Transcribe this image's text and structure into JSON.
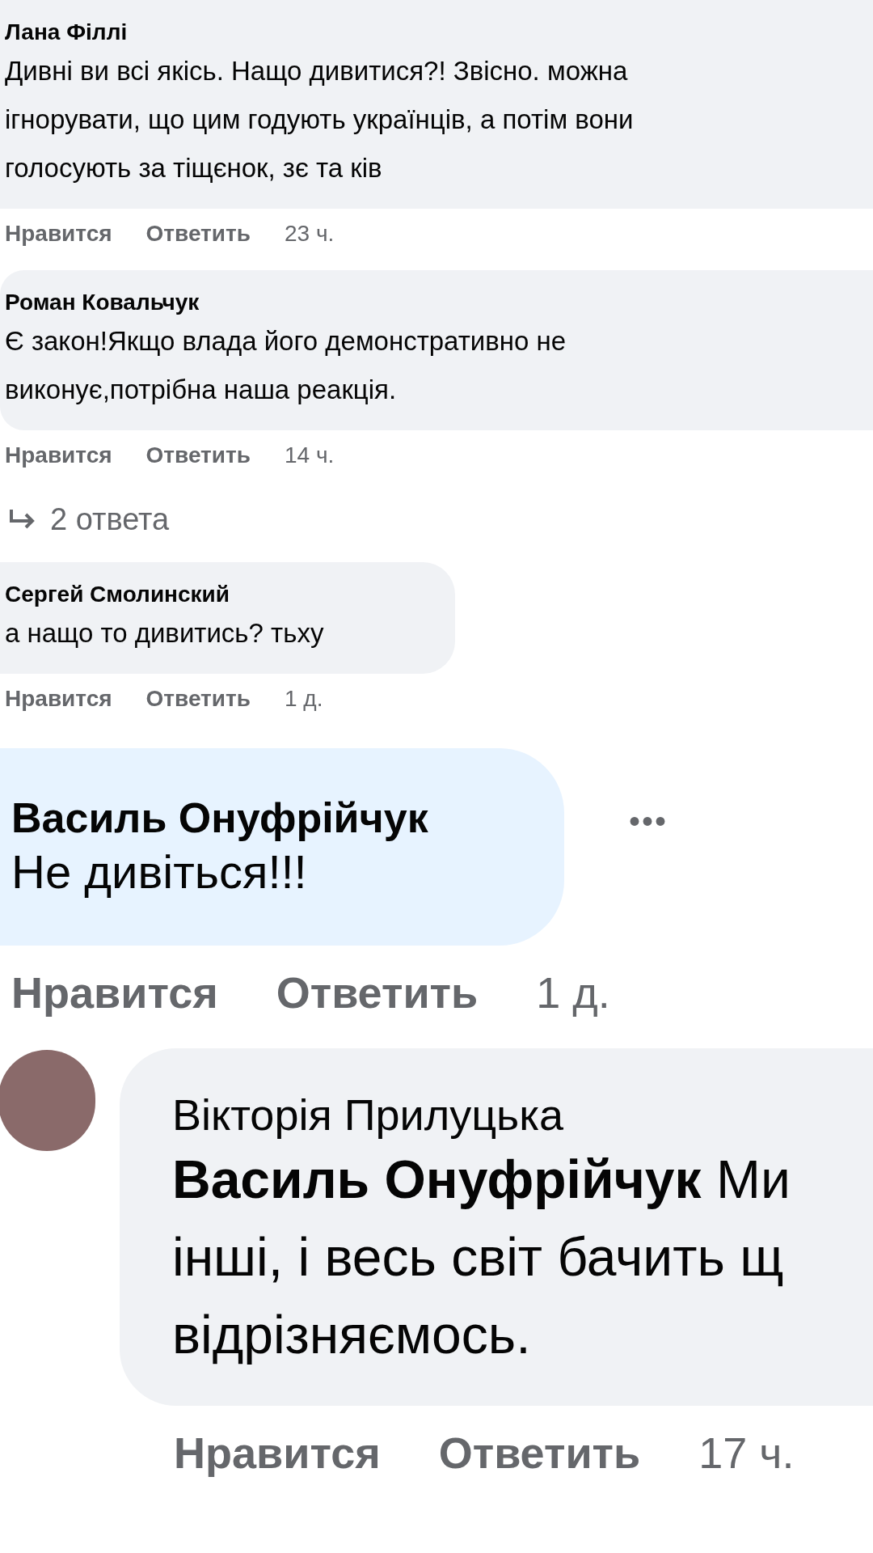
{
  "comments": [
    {
      "kind": "small",
      "color": "#f0f2f5",
      "author": "Лана Філлі",
      "lines": [
        "Дивні ви всі якісь. Нащо дивитися?! Звісно. можна",
        "ігнорувати, що цим годують українців, а потім вони",
        "голосують за тіщєнок, зє та ків"
      ],
      "actions": [
        "Нравится",
        "Ответить"
      ],
      "time": "23 ч."
    },
    {
      "kind": "small",
      "color": "#f0f2f5",
      "author": "Роман Ковальчук",
      "lines": [
        "Є закон!Якщо влада його демонстративно не",
        "виконує,потрібна наша реакція."
      ],
      "actions": [
        "Нравится",
        "Ответить"
      ],
      "time": "14 ч.",
      "replies": "2 ответа"
    },
    {
      "kind": "small",
      "color": "#f0f2f5",
      "author": "Сергей Смолинский",
      "lines": [
        "а нащо то дивитись? тьху"
      ],
      "actions": [
        "Нравится",
        "Ответить"
      ],
      "time": "1 д."
    },
    {
      "kind": "large",
      "color": "#e7f3ff",
      "author": "Василь Онуфрійчук",
      "lines": [
        "Не дивіться!!!"
      ],
      "actions": [
        "Нравится",
        "Ответить"
      ],
      "time": "1 д.",
      "more": "•••"
    },
    {
      "kind": "large",
      "color": "#f0f2f5",
      "avatar": true,
      "author": "Вікторія Прилуцька",
      "lines": [
        "**Василь Онуфрійчук** Ми",
        "інші, і весь світ бачить щ",
        "відрізняємось."
      ],
      "actions": [
        "Нравится",
        "Ответить"
      ],
      "time": "17 ч."
    }
  ]
}
